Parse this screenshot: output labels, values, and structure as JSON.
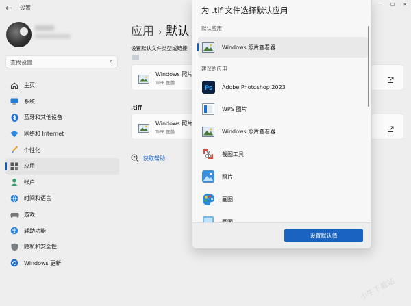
{
  "window": {
    "title": "设置",
    "controls": [
      "—",
      "☐",
      "✕"
    ]
  },
  "profile": {
    "email_suffix": "****@****.com"
  },
  "search": {
    "placeholder": "查找设置"
  },
  "sidebar": {
    "items": [
      {
        "label": "主页",
        "icon": "home-icon",
        "active": false
      },
      {
        "label": "系统",
        "icon": "system-icon",
        "active": false
      },
      {
        "label": "蓝牙和其他设备",
        "icon": "bluetooth-icon",
        "active": false
      },
      {
        "label": "网络和 Internet",
        "icon": "wifi-icon",
        "active": false
      },
      {
        "label": "个性化",
        "icon": "brush-icon",
        "active": false
      },
      {
        "label": "应用",
        "icon": "apps-icon",
        "active": true
      },
      {
        "label": "帐户",
        "icon": "account-icon",
        "active": false
      },
      {
        "label": "时间和语言",
        "icon": "globe-icon",
        "active": false
      },
      {
        "label": "游戏",
        "icon": "gamepad-icon",
        "active": false
      },
      {
        "label": "辅助功能",
        "icon": "accessibility-icon",
        "active": false
      },
      {
        "label": "隐私和安全性",
        "icon": "shield-icon",
        "active": false
      },
      {
        "label": "Windows 更新",
        "icon": "update-icon",
        "active": false
      }
    ]
  },
  "main": {
    "breadcrumb": {
      "parent": "应用",
      "separator": "›",
      "current": "默认"
    },
    "section_hint": "设置默认文件类型或链接",
    "card1": {
      "title": "Windows 照片",
      "subtitle": "TIFF 图像"
    },
    "extension_label": ".tiff",
    "card2": {
      "title": "Windows 照片",
      "subtitle": "TIFF 图像"
    },
    "help": "获取帮助"
  },
  "dialog": {
    "title": "为 .tif 文件选择默认应用",
    "default_section": "默认应用",
    "default_app": {
      "label": "Windows 照片查看器",
      "icon": "photo-viewer-icon"
    },
    "suggested_section": "建议的应用",
    "apps": [
      {
        "label": "Adobe Photoshop 2023",
        "icon": "photoshop-icon"
      },
      {
        "label": "WPS 图片",
        "icon": "wps-pictures-icon"
      },
      {
        "label": "Windows 照片查看器",
        "icon": "photo-viewer-icon"
      },
      {
        "label": "截图工具",
        "icon": "snipping-tool-icon"
      },
      {
        "label": "照片",
        "icon": "photos-icon"
      },
      {
        "label": "画图",
        "icon": "paint-icon"
      },
      {
        "label": "画图",
        "icon": "paint3d-icon"
      }
    ],
    "set_default_button": "设置默认值"
  },
  "watermark": "小牛下载站",
  "colors": {
    "accent": "#1a63c0",
    "background": "#eeeeee",
    "dialog_bg": "#f7f7f7"
  }
}
